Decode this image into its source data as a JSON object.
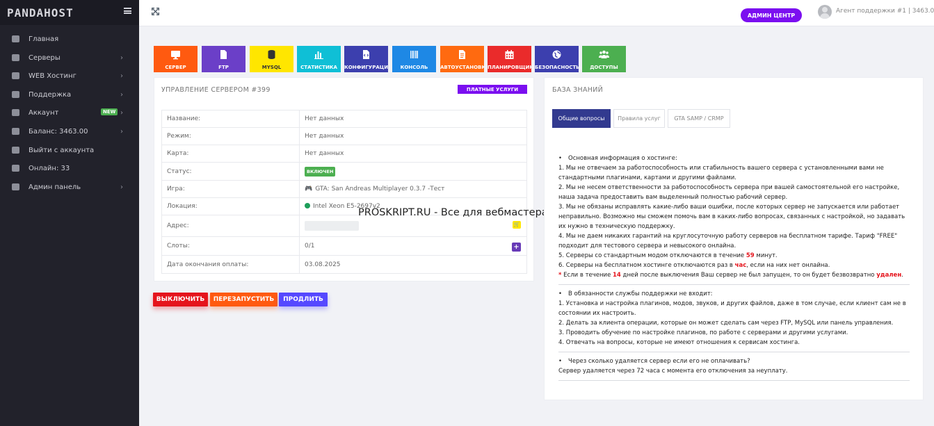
{
  "brand": {
    "logo": "PANDAHOST"
  },
  "sidebar": {
    "items": [
      {
        "label": "Главная",
        "icon": "home-icon",
        "chevron": false,
        "badge": ""
      },
      {
        "label": "Серверы",
        "icon": "gamepad-icon",
        "chevron": true,
        "badge": ""
      },
      {
        "label": "WEB Хостинг",
        "icon": "hdd-icon",
        "chevron": true,
        "badge": ""
      },
      {
        "label": "Поддержка",
        "icon": "users-icon",
        "chevron": true,
        "badge": ""
      },
      {
        "label": "Аккаунт",
        "icon": "gear-icon",
        "chevron": true,
        "badge": "NEW"
      },
      {
        "label": "Баланс: 3463.00",
        "icon": "wallet-icon",
        "chevron": true,
        "badge": ""
      },
      {
        "label": "Выйти с аккаунта",
        "icon": "logout-icon",
        "chevron": false,
        "badge": ""
      },
      {
        "label": "Онлайн: 33",
        "icon": "users-icon",
        "chevron": false,
        "badge": ""
      },
      {
        "label": "Админ панель",
        "icon": "globe-icon",
        "chevron": true,
        "badge": ""
      }
    ],
    "chevron_glyph": "›"
  },
  "topbar": {
    "admin_label": "АДМИН ЦЕНТР",
    "agent_text": "Агент поддержки #1 | 3463.00 Р"
  },
  "tiles": [
    {
      "label": "СЕРВЕР",
      "color": "#ff5a10",
      "icon": "monitor-icon"
    },
    {
      "label": "FTP",
      "color": "#6b3fc8",
      "icon": "file-icon"
    },
    {
      "label": "MYSQL",
      "color": "#ffe600",
      "icon": "database-icon"
    },
    {
      "label": "СТАТИСТИКА",
      "color": "#0fbfd6",
      "icon": "bar-chart-icon"
    },
    {
      "label": "КОНФИГУРАЦИЯ",
      "color": "#3c3fae",
      "icon": "code-file-icon"
    },
    {
      "label": "КОНСОЛЬ",
      "color": "#1e88e5",
      "icon": "barcode-icon"
    },
    {
      "label": "АВТОУСТАНОВКА",
      "color": "#ff6a10",
      "icon": "document-icon"
    },
    {
      "label": "ПЛАНИРОВЩИК",
      "color": "#ea2b2b",
      "icon": "calendar-icon"
    },
    {
      "label": "БЕЗОПАСНОСТЬ",
      "color": "#3c3fae",
      "icon": "globe-icon"
    },
    {
      "label": "ДОСТУПЫ",
      "color": "#4caf50",
      "icon": "users-icon"
    }
  ],
  "server": {
    "title": "УПРАВЛЕНИЕ СЕРВЕРОМ #399",
    "paid_label": "ПЛАТНЫЕ УСЛУГИ",
    "rows": [
      {
        "key": "Название:",
        "value": "Нет данных",
        "type": "text"
      },
      {
        "key": "Режим:",
        "value": "Нет данных",
        "type": "text"
      },
      {
        "key": "Карта:",
        "value": "Нет данных",
        "type": "text"
      },
      {
        "key": "Статус:",
        "value": "ВКЛЮЧЕН",
        "type": "badge"
      },
      {
        "key": "Игра:",
        "value": "GTA: San Andreas Multiplayer 0.3.7 -Тест",
        "type": "game"
      },
      {
        "key": "Локация:",
        "value": "Intel Xeon E5-2697v2",
        "type": "location"
      },
      {
        "key": "Адрес:",
        "value": "",
        "type": "address"
      },
      {
        "key": "Слоты:",
        "value": "0/1",
        "type": "slots"
      },
      {
        "key": "Дата окончания оплаты:",
        "value": "03.08.2025",
        "type": "text"
      }
    ]
  },
  "watermark": "PROSKRIPT.RU - Все для вебмастера",
  "actions": {
    "off": "ВЫКЛЮЧИТЬ",
    "restart": "ПЕРЕЗАПУСТИТЬ",
    "extend": "ПРОДЛИТЬ"
  },
  "kb": {
    "title": "БАЗА ЗНАНИЙ",
    "tabs": [
      "Общие вопросы",
      "Правила услуг",
      "GTA SAMP / CRMP"
    ],
    "section1": {
      "heading": "Основная информация о хостинге:",
      "l1": "1. Мы не отвечаем за работоспособность или стабильность вашего сервера с установленными вами не стандартными плагинами, картами и другими файлами.",
      "l2": "2. Мы не несем ответственности за работоспособность сервера при вашей самостоятельной его настройке, наша задача предоставить вам выделенный полностью рабочий сервер.",
      "l3": "3. Мы не обязаны исправлять какие-либо ваши ошибки, после которых сервер не запускается или работает неправильно. Возможно мы сможем помочь вам в каких-либо вопросах, связанных с настройкой, но задавать их нужно в техническую поддержку.",
      "l4": "4. Мы не даем никаких гарантий на круглосуточную работу серверов на бесплатном тарифе. Тариф \"FREE\" подходит для тестового сервера и невысокого онлайна.",
      "l5a": "5. Серверы со стандартным модом отключаются в течение ",
      "l5b": "59",
      "l5c": " минут.",
      "l6a": "6. Серверы на бесплатном хостинге отключаются раз в ",
      "l6b": "час",
      "l6c": ", если на них нет онлайна.",
      "l7star": "*",
      "l7a": " Если в течение ",
      "l7b": "14",
      "l7c": " дней после выключения Ваш сервер не был запущен, то он будет безвозвратно ",
      "l7d": "удален",
      "l7e": "."
    },
    "section2": {
      "heading": "В обязанности службы поддержки не входит:",
      "l1": "1. Установка и настройка плагинов, модов, звуков, и других файлов, даже в том случае, если клиент сам не в состоянии их настроить.",
      "l2": "2. Делать за клиента операции, которые он может сделать сам через FTP, MySQL или панель управления.",
      "l3": "3. Проводить обучение по настройке плагинов, по работе с серверами и другими услугами.",
      "l4": "4. Отвечать на вопросы, которые не имеют отношения к сервисам хостинга."
    },
    "section3": {
      "heading": "Через сколько удаляется сервер если его не оплачивать?",
      "l1": "Сервер удаляется через 72 часа с момента его отключения за неуплату."
    }
  }
}
